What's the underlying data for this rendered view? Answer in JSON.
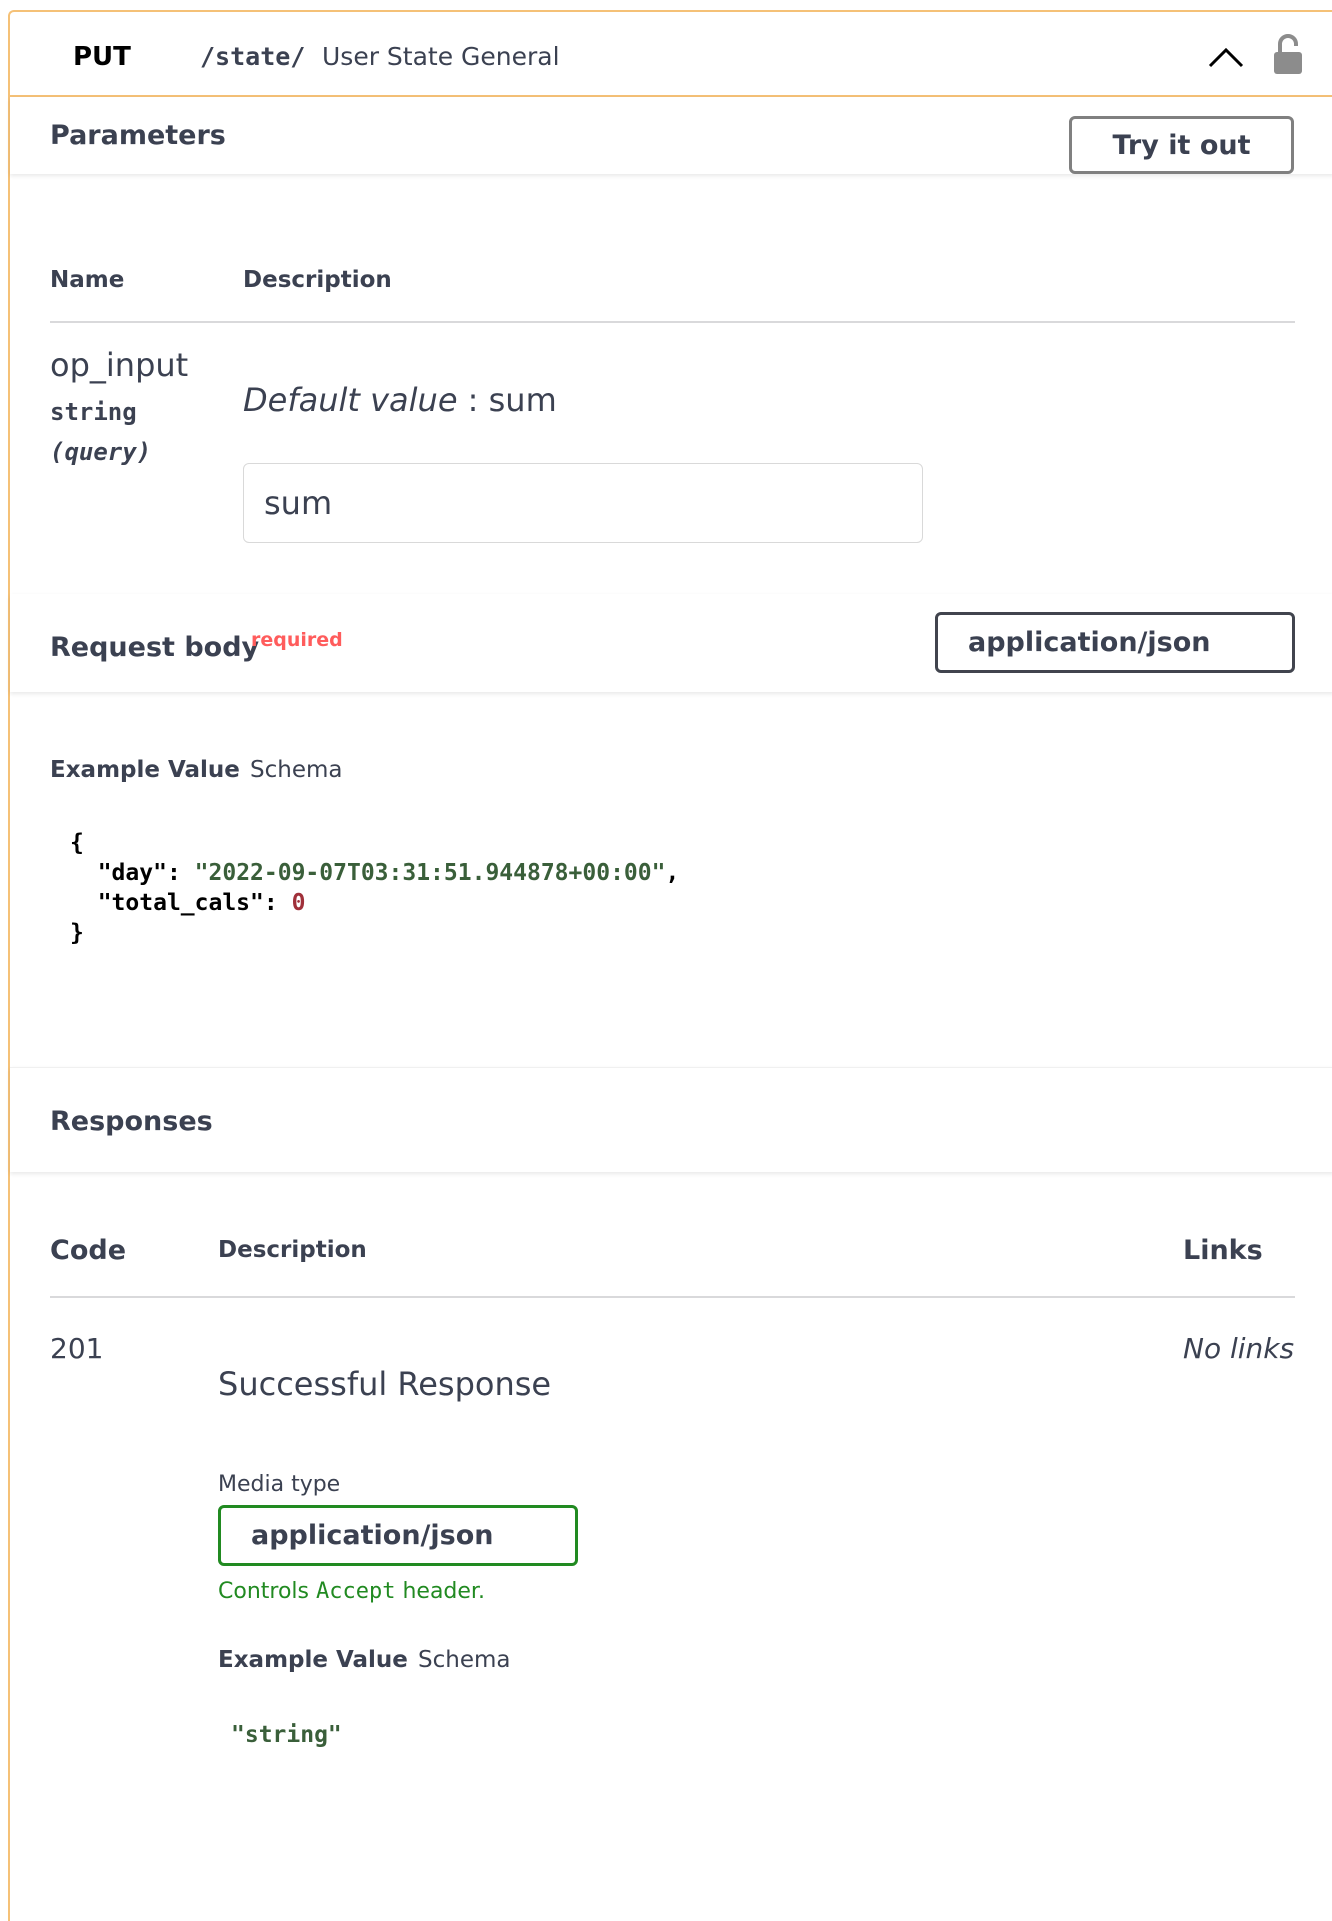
{
  "operation": {
    "method": "PUT",
    "path": "/state/",
    "summary": "User State General"
  },
  "parameters": {
    "title": "Parameters",
    "try_label": "Try it out",
    "col_name": "Name",
    "col_description": "Description",
    "items": [
      {
        "name": "op_input",
        "type": "string",
        "in": "(query)",
        "default_label": "Default value",
        "default_sep": " : ",
        "default_value": "sum",
        "input_value": "sum"
      }
    ]
  },
  "request_body": {
    "title": "Request body",
    "required_label": "required",
    "content_type": "application/json",
    "tab_example": "Example Value",
    "tab_schema": "Schema",
    "example": {
      "open": "{",
      "day_key": "\"day\"",
      "day_value": "\"2022-09-07T03:31:51.944878+00:00\"",
      "cals_key": "\"total_cals\"",
      "cals_value": "0",
      "close": "}"
    }
  },
  "responses": {
    "title": "Responses",
    "col_code": "Code",
    "col_description": "Description",
    "col_links": "Links",
    "items": [
      {
        "code": "201",
        "description": "Successful Response",
        "links": "No links",
        "media_type_label": "Media type",
        "media_type": "application/json",
        "controls_pre": "Controls ",
        "controls_code": "Accept",
        "controls_post": " header.",
        "tab_example": "Example Value",
        "tab_schema": "Schema",
        "example": "\"string\""
      }
    ]
  },
  "colors": {
    "put_border": "#f5c177",
    "required": "#ff5c5c",
    "media_green": "#218a21"
  }
}
